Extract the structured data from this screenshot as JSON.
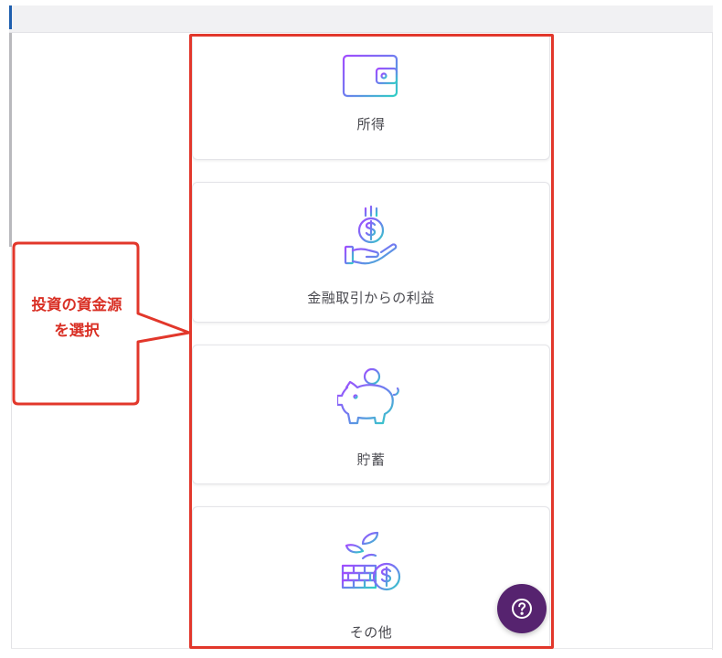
{
  "source_options": [
    {
      "label": "所得",
      "icon": "wallet-icon"
    },
    {
      "label": "金融取引からの利益",
      "icon": "hand-coin-icon"
    },
    {
      "label": "貯蓄",
      "icon": "piggy-bank-icon"
    },
    {
      "label": "その他",
      "icon": "plant-coin-icon"
    }
  ],
  "annotation": {
    "line1": "投資の資金源",
    "line2": "を選択",
    "color": "#e2372b"
  },
  "help_button": {
    "icon": "question-mark-icon",
    "color": "#56236f"
  },
  "colors": {
    "icon_gradient_start": "#9b4dff",
    "icon_gradient_end": "#35c6c9"
  }
}
